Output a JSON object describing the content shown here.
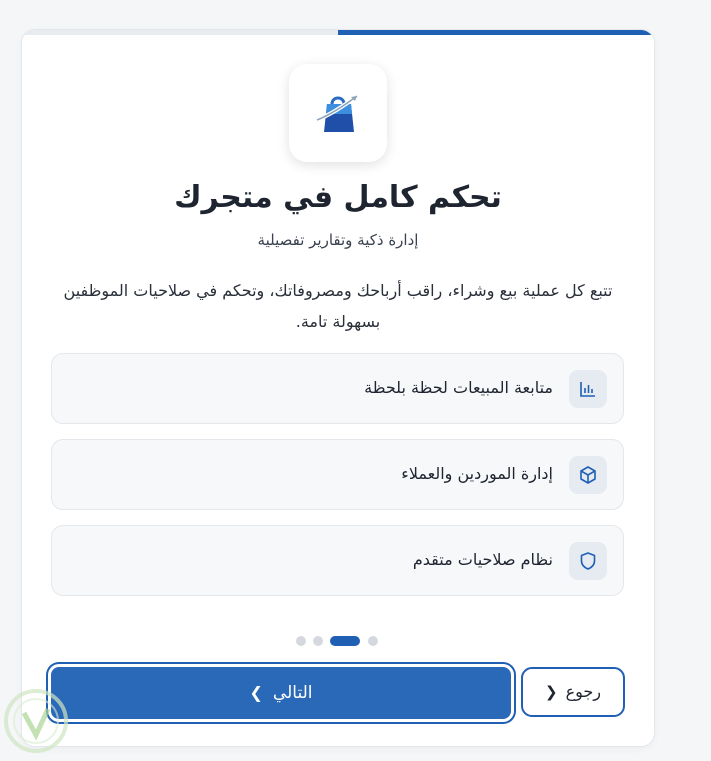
{
  "onboarding": {
    "progress_fraction": 0.5,
    "title": "تحكم كامل في متجرك",
    "subtitle": "إدارة ذكية وتقارير تفصيلية",
    "description": "تتبع كل عملية بيع وشراء، راقب أرباحك ومصروفاتك، وتحكم في صلاحيات الموظفين بسهولة تامة.",
    "features": [
      {
        "label": "متابعة المبيعات لحظة بلحظة",
        "icon": "bar-chart-icon"
      },
      {
        "label": "إدارة الموردين والعملاء",
        "icon": "box-icon"
      },
      {
        "label": "نظام صلاحيات متقدم",
        "icon": "shield-icon"
      }
    ],
    "steps": {
      "total": 4,
      "current": 3
    },
    "buttons": {
      "next_label": "التالي",
      "back_label": "رجوع"
    }
  },
  "colors": {
    "accent": "#1f5fb4",
    "card_bg": "#ffffff",
    "feature_bg": "#f7f8fa",
    "icon_tile": "#e6ebf2"
  }
}
